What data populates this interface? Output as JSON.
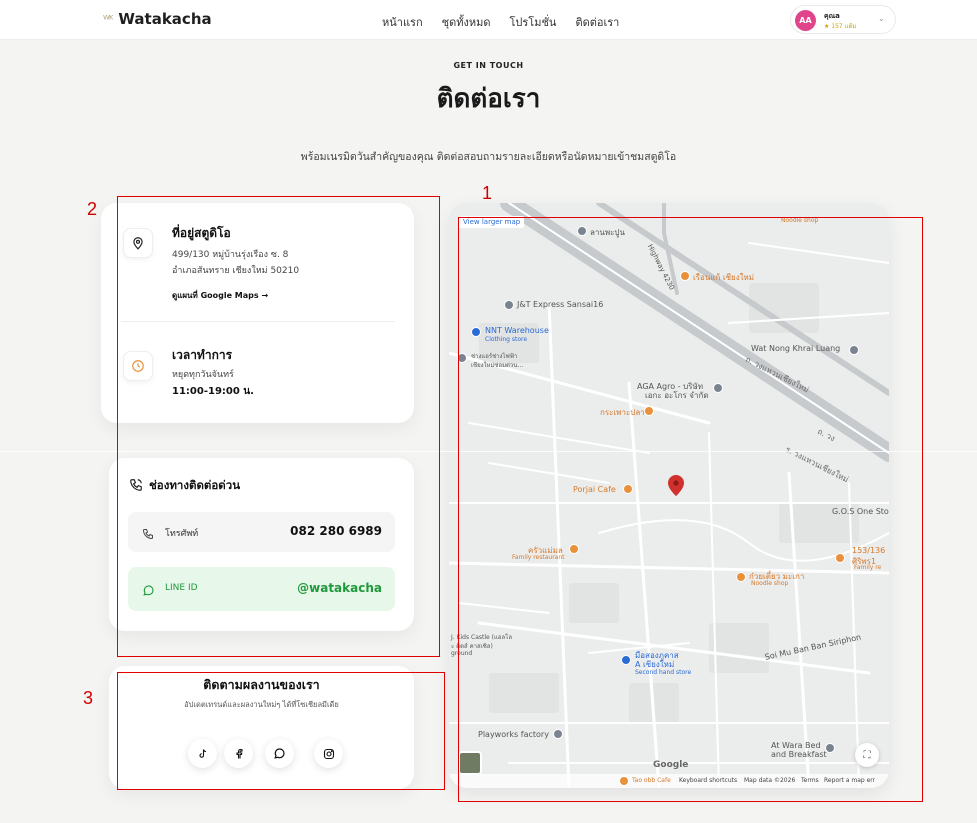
{
  "header": {
    "logo_mark": "ᵂᴷ",
    "logo_text": "Watakacha",
    "nav": [
      "หน้าแรก",
      "ชุดทั้งหมด",
      "โปรโมชั่น",
      "ติดต่อเรา"
    ],
    "user": {
      "initials": "AA",
      "name": "คุณa",
      "points": "★ 157 แต้ม"
    }
  },
  "hero": {
    "eyebrow": "GET IN TOUCH",
    "title": "ติดต่อเรา",
    "subtitle": "พร้อมเนรมิตวันสำคัญของคุณ ติดต่อสอบถามรายละเอียดหรือนัดหมายเข้าชมสตูดิโอ"
  },
  "studio": {
    "title": "ที่อยู่สตูดิโอ",
    "address_line1": "499/130 หมู่บ้านรุ่งเรือง ซ. 8",
    "address_line2": "อำเภอสันทราย เชียงใหม่ 50210",
    "map_link": "ดูแผนที่ Google Maps →"
  },
  "hours": {
    "title": "เวลาทำการ",
    "closed": "หยุดทุกวันจันทร์",
    "time": "11:00-19:00 น."
  },
  "contact": {
    "title": "ช่องทางติดต่อด่วน",
    "phone_label": "โทรศัพท์",
    "phone_value": "082 280 6989",
    "line_label": "LINE ID",
    "line_value": "@watakacha"
  },
  "social": {
    "title": "ติดตามผลงานของเรา",
    "subtitle": "อัปเดตเทรนด์และผลงานใหม่ๆ ได้ที่โซเชียลมีเดีย",
    "icons": [
      "tiktok-icon",
      "facebook-icon",
      "line-icon",
      "instagram-icon"
    ]
  },
  "map": {
    "view_larger": "View larger map",
    "labels": {
      "jt": "J&T Express Sansai16",
      "nnt": "NNT Warehouse",
      "nnt_sub": "Clothing store",
      "noodle_top": "Noodle shop",
      "ruenkae": "เรือนแก้ เชียงใหม่",
      "wat": "Wat Nong Khrai Luang",
      "aga1": "AGA Agro - บริษัท",
      "aga2": "เอกะ อะโกร จำกัด",
      "krapao": "กระเพาะปลา",
      "ladnongpun": "ลานพะปูน",
      "changrepair1": "ช่างแอร์ช่างไฟฟ้า",
      "changrepair2": "เชียงใหม่ซ่อมด่วน...",
      "porjai": "Porjai Cafe",
      "kruamae": "ครัวแม่มล",
      "kruamae_sub": "Family restaurant",
      "gos": "G.O.S One Sto",
      "num153": "153/136",
      "num153b": "ศิริพร1",
      "family_re": "Family re",
      "kuay": "ก๋วยเตี๋ยว มะเกา",
      "kuay_sub": "Noodle shop",
      "kids1": "J. Kids Castle (แอลโล",
      "kids2": "ะ คิดส์ คาสเซิล)",
      "kids3": "ground",
      "mue1": "มือสองภูคาส",
      "mue2": "A เชียงใหม่",
      "mue_sub": "Second hand store",
      "soi": "Soi Mu Ban Ban Siriphon",
      "playworks": "Playworks factory",
      "atwara1": "At Wara Bed",
      "atwara2": "and Breakfast",
      "taoob": "Tao obb Cafe",
      "road_chiangmai": "ถ. วงแหวนเชียงใหม่",
      "highway": "Highway 4230",
      "road_ru": "ร. วงแหวนเชียงใหม่",
      "road_ri": "ถ. วง"
    },
    "google": "Google",
    "footer": [
      "Keyboard shortcuts",
      "Map data ©2026",
      "Terms",
      "Report a map err"
    ]
  },
  "annotations": [
    "1",
    "2",
    "3"
  ],
  "colors": {
    "accent_orange": "#e8913a",
    "line_green": "#1f9a3a",
    "map_pin_red": "#d0312d",
    "annotation_red": "#e00000"
  }
}
